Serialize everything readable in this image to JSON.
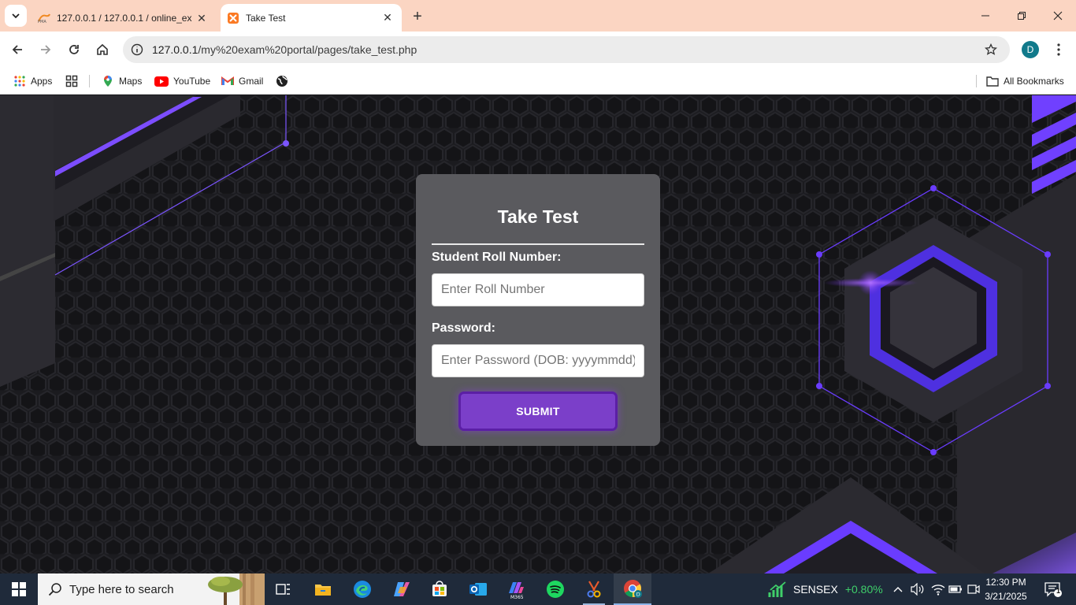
{
  "browser": {
    "tabs": [
      {
        "title": "127.0.0.1 / 127.0.0.1 / online_ex",
        "favicon": "phpmyadmin-icon",
        "active": false
      },
      {
        "title": "Take Test",
        "favicon": "xampp-icon",
        "active": true
      }
    ],
    "address": {
      "host": "127.0.0.1",
      "path": "/my%20exam%20portal/pages/take_test.php"
    },
    "profile_initial": "D",
    "bookmarks": [
      {
        "label": "Apps",
        "icon": "apps-grid-icon"
      },
      {
        "label": "",
        "icon": "tab-groups-icon"
      },
      {
        "label": "Maps",
        "icon": "maps-pin-icon"
      },
      {
        "label": "YouTube",
        "icon": "youtube-icon"
      },
      {
        "label": "Gmail",
        "icon": "gmail-icon"
      },
      {
        "label": "",
        "icon": "globe-icon"
      }
    ],
    "all_bookmarks": "All Bookmarks"
  },
  "form": {
    "title": "Take Test",
    "roll_label": "Student Roll Number:",
    "roll_placeholder": "Enter Roll Number",
    "roll_value": "",
    "password_label": "Password:",
    "password_placeholder": "Enter Password (DOB: yyyymmdd)",
    "password_value": "",
    "submit_label": "SUBMIT"
  },
  "taskbar": {
    "search_placeholder": "Type here to search",
    "apps": [
      "task-view-icon",
      "file-explorer-icon",
      "edge-icon",
      "copilot-icon",
      "store-icon",
      "outlook-icon",
      "m365-icon",
      "spotify-icon",
      "snipping-tool-icon",
      "chrome-icon"
    ],
    "ticker_name": "SENSEX",
    "ticker_change": "+0.80%",
    "time": "12:30 PM",
    "date": "3/21/2025",
    "notification_count": "1"
  },
  "colors": {
    "tabstrip": "#fbd5c2",
    "accent_purple": "#7b3fc9",
    "card_bg": "#5a5a5e",
    "taskbar": "#1f2a3a"
  }
}
